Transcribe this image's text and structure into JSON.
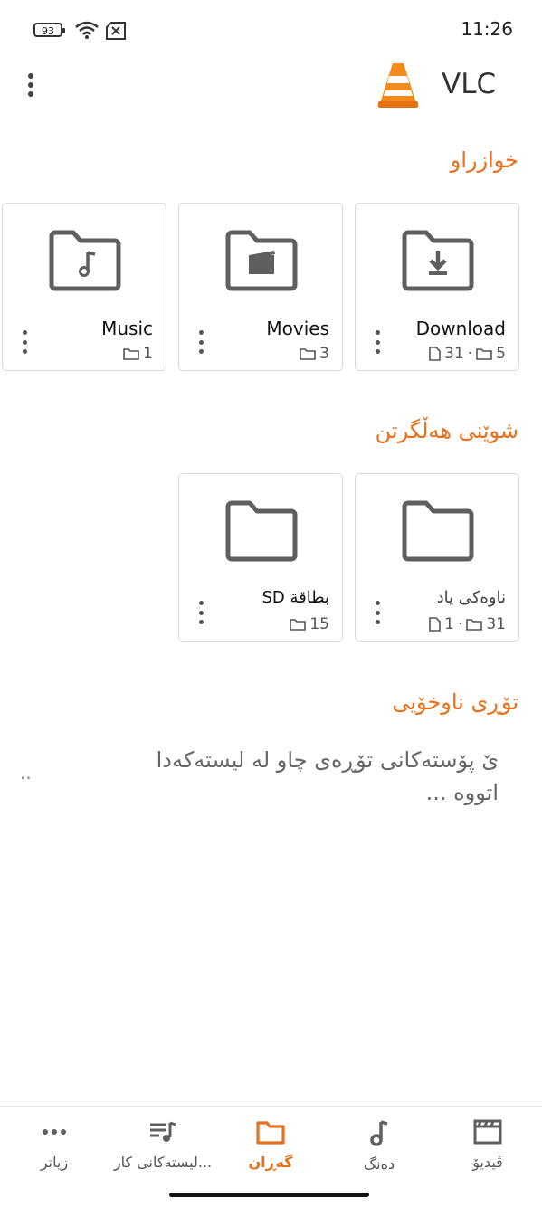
{
  "status_bar": {
    "time": "11:26",
    "battery": "93"
  },
  "app_bar": {
    "title": "VLC"
  },
  "sections": {
    "favorites": {
      "title": "خوازراو",
      "items": [
        {
          "name": "Download",
          "files": "31",
          "sep": "·",
          "folders": "5",
          "icon": "download-folder-icon"
        },
        {
          "name": "Movies",
          "folders": "3",
          "icon": "movies-folder-icon"
        },
        {
          "name": "Music",
          "folders": "1",
          "icon": "music-folder-icon"
        }
      ]
    },
    "storage": {
      "title": "شوێنی هەڵگرتن",
      "items": [
        {
          "name": "ناوەکی یاد",
          "files": "1",
          "sep": "·",
          "folders": "31",
          "icon": "folder-icon"
        },
        {
          "name": "بطاقة SD",
          "folders": "15",
          "icon": "folder-icon"
        }
      ]
    },
    "network": {
      "title": "تۆڕی ناوخۆیی",
      "line1": "ێ پۆستەکانی تۆڕەی چاو لە لیستەکەدا",
      "line2": "اتووە ...",
      "side": ".."
    }
  },
  "bottom_nav": [
    {
      "label": "ڤیدیۆ",
      "icon": "video-icon"
    },
    {
      "label": "دەنگ",
      "icon": "music-note-icon"
    },
    {
      "label": "گەڕان",
      "icon": "folder-icon",
      "active": true
    },
    {
      "label": "لیستەکانی کار...",
      "icon": "playlist-icon"
    },
    {
      "label": "زیاتر",
      "icon": "more-icon"
    }
  ],
  "colors": {
    "accent": "#e8701a",
    "icon_gray": "#5f5f5f"
  }
}
